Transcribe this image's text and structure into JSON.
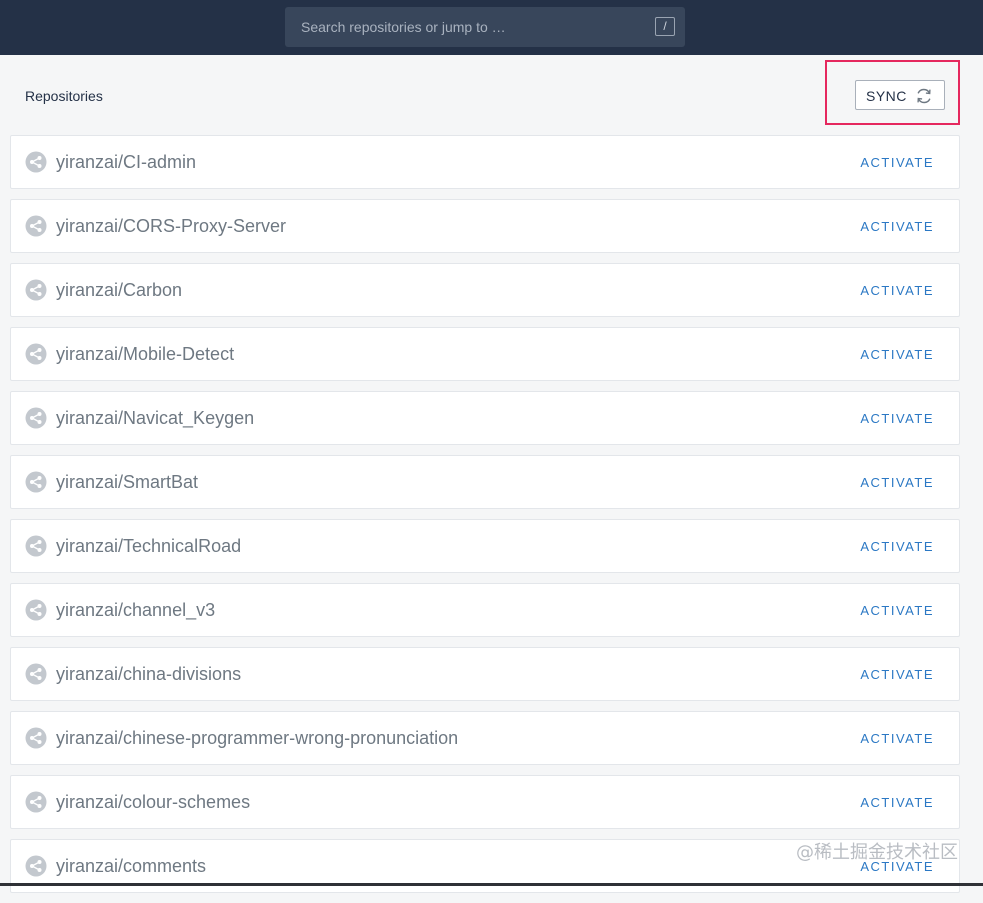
{
  "search": {
    "placeholder": "Search repositories or jump to …",
    "shortcut": "/"
  },
  "main": {
    "heading": "Repositories",
    "sync_label": "SYNC",
    "sync_icon": "refresh-icon",
    "highlight_color": "#e5285e"
  },
  "repos": [
    {
      "name": "yiranzai/CI-admin",
      "action": "ACTIVATE"
    },
    {
      "name": "yiranzai/CORS-Proxy-Server",
      "action": "ACTIVATE"
    },
    {
      "name": "yiranzai/Carbon",
      "action": "ACTIVATE"
    },
    {
      "name": "yiranzai/Mobile-Detect",
      "action": "ACTIVATE"
    },
    {
      "name": "yiranzai/Navicat_Keygen",
      "action": "ACTIVATE"
    },
    {
      "name": "yiranzai/SmartBat",
      "action": "ACTIVATE"
    },
    {
      "name": "yiranzai/TechnicalRoad",
      "action": "ACTIVATE"
    },
    {
      "name": "yiranzai/channel_v3",
      "action": "ACTIVATE"
    },
    {
      "name": "yiranzai/china-divisions",
      "action": "ACTIVATE"
    },
    {
      "name": "yiranzai/chinese-programmer-wrong-pronunciation",
      "action": "ACTIVATE"
    },
    {
      "name": "yiranzai/colour-schemes",
      "action": "ACTIVATE"
    },
    {
      "name": "yiranzai/comments",
      "action": "ACTIVATE"
    }
  ],
  "repo_icon": "share-icon",
  "watermark": "@稀土掘金技术社区",
  "colors": {
    "topbar": "#243147",
    "link": "#2b78c4"
  }
}
